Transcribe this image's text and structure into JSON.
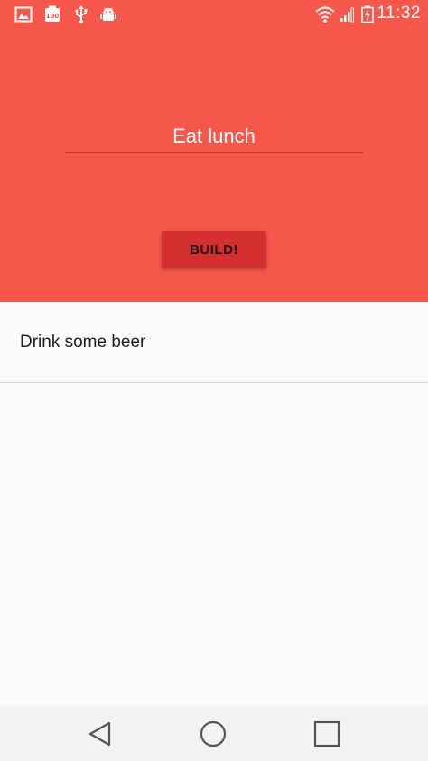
{
  "status_bar": {
    "time": "11:32",
    "icons": [
      "image-icon",
      "battery-saver-100-icon",
      "usb-icon",
      "android-debug-icon",
      "wifi-icon",
      "signal-icon",
      "battery-charging-icon"
    ],
    "battery_saver_label": "100"
  },
  "form": {
    "task_value": "Eat lunch",
    "build_label": "BUILD!"
  },
  "list": {
    "items": [
      {
        "label": "Drink some beer"
      }
    ]
  },
  "nav": {
    "icons": [
      "back-icon",
      "home-icon",
      "recents-icon"
    ]
  },
  "colors": {
    "primary": "#f6574b",
    "accent": "#d32f2f",
    "background": "#fafafa"
  }
}
